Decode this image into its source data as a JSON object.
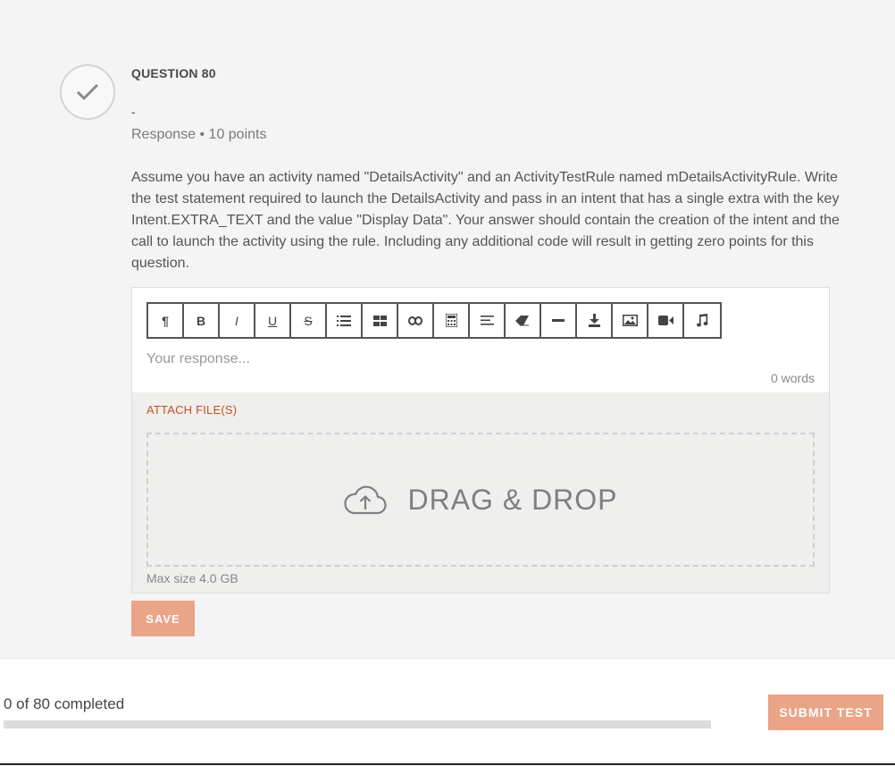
{
  "question": {
    "label": "QUESTION 80",
    "dash": "-",
    "meta": "Response • 10 points",
    "text": "Assume you have an activity named \"DetailsActivity\" and an ActivityTestRule named mDetailsActivityRule. Write the test statement required to launch the DetailsActivity and pass in an intent that has a single extra with the key Intent.EXTRA_TEXT and the value \"Display Data\". Your answer should contain the creation of the intent and the call to launch the activity using the rule. Including any additional code will result in getting zero points for this question."
  },
  "editor": {
    "toolbar": {
      "paragraph": "¶",
      "bold": "B",
      "italic": "I",
      "underline": "U",
      "strikethrough": "S"
    },
    "toolbar_icons": [
      "paragraph-icon",
      "bold-icon",
      "italic-icon",
      "underline-icon",
      "strikethrough-icon",
      "bulleted-list-icon",
      "table-icon",
      "link-icon",
      "calculator-icon",
      "align-icon",
      "eraser-icon",
      "horizontal-rule-icon",
      "download-icon",
      "image-icon",
      "video-icon",
      "music-icon"
    ],
    "placeholder": "Your response...",
    "word_count": "0 words"
  },
  "attach": {
    "label": "ATTACH FILE(S)",
    "dropzone": "DRAG & DROP",
    "max_size": "Max size 4.0 GB"
  },
  "save_label": "SAVE",
  "footer": {
    "progress_text": "0 of 80 completed",
    "progress_fraction": 0,
    "submit_label": "SUBMIT TEST"
  },
  "colors": {
    "accent": "#eaa487",
    "attach_label": "#c4521e"
  }
}
